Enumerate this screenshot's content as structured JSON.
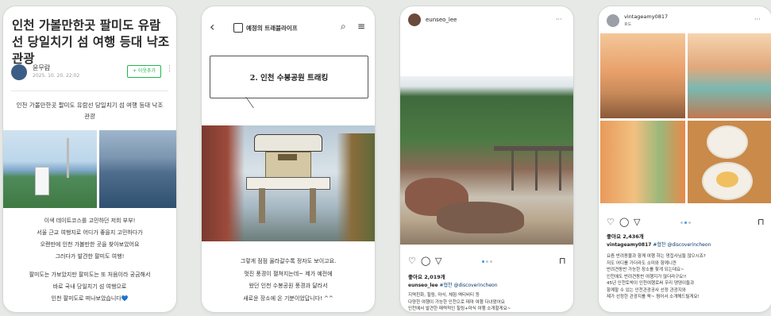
{
  "phone1": {
    "title": "인천 가볼만한곳 팔미도 유람선 당일치기 섬 여행 등대 낙조 관광",
    "author": "윤무람",
    "date": "2025. 10. 20. 22:02",
    "follow_label": "+ 이웃추가",
    "kebab": "⋮",
    "subtitle": "인천 가볼만한곳 팔미도 유람선 당일치기 섬 여행 등대 낙조 관광",
    "body_lines_1": [
      "이색 데이트코스를 고민하던 저희 부부!",
      "서울 근교 여행지로 어디가 좋을지 고민하다가",
      "오랜만에 인천 가볼만한 곳을 찾아보았어요",
      "그러다가 발견한 팔미도 여행!"
    ],
    "body_lines_2": [
      "팔미도는 가보았지만 팔미도는 또 처음이라 궁금해서",
      "바로 국내 당일치기 섬 여행으로",
      "인천 팔미도로 떠나보았습니다💙"
    ]
  },
  "phone2": {
    "brand": "예정의 트래블라이프",
    "heading": "2. 인천 수봉공원 트래킹",
    "caption_lines": [
      "그렇게 점점 올라갈수록 정자도 보이고요.",
      "멋진 풍경이 펼쳐지는데~ 제가 예전에",
      "왔던 인천 수봉공원 풍경과 달라서",
      "새로운 장소에 온 기분이었답니다! ^^"
    ]
  },
  "phone3": {
    "username": "eunseo_lee",
    "more": "···",
    "likes": "좋아요 2,019개",
    "caption_user": "eunseo_lee",
    "caption_tags": "#협찬 @discoverincheon",
    "caption_lines": [
      "지역친화, 힐링, 마식, 체험·액티비티 등",
      "다양한 여행이 가능한 인천으로 테마 여행 다녀왔어요",
      "인천에서 발견한 매력적인 힐링+마식 여행 소개할게요~"
    ]
  },
  "phone4": {
    "username": "vintageamy0817",
    "location": "호도",
    "more": "···",
    "likes": "좋아요 2,436개",
    "caption_user": "vintageamy0817",
    "caption_tags": "#협찬 @discoverincheon",
    "caption_lines": [
      "요즘 반려동물과 함께 여행 하는 댕집사님들 많으시죠?",
      "저도 어디를 가더라도 소미와 함께니깐",
      "반려견동반 가능한 장소를 찾게 되는데요~",
      "인천에도 반려견동반 여행지가 많더라구요!!",
      "45년 인천토박이 인천여행로써 우리 댕댕이들과",
      "함께할 수 있는 인천관광공사 선정 관광지와",
      "제가 선정한 관광지를 쭉~ 찜어서 소개해드릴게요!"
    ]
  },
  "icons": {
    "heart": "♡",
    "comment": "◯",
    "send": "▽",
    "bookmark": "⊓",
    "back": "‹",
    "search": "⌕",
    "menu": "≡"
  },
  "colors": {
    "follow_green": "#1fb74a",
    "dot_active": "#3897f0"
  }
}
